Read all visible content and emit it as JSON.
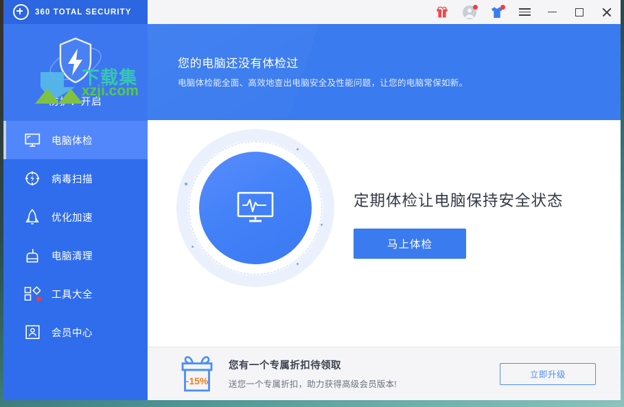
{
  "window": {
    "brand": "360 TOTAL SECURITY",
    "logo_icon": "plus-circle-icon"
  },
  "titlebar": {
    "icons": [
      {
        "name": "gift-icon",
        "badge": false
      },
      {
        "name": "user-avatar-icon",
        "badge": true
      },
      {
        "name": "skin-shirt-icon",
        "badge": true
      },
      {
        "name": "menu-hamburger-icon",
        "badge": false
      }
    ],
    "controls": [
      {
        "name": "minimize-button"
      },
      {
        "name": "maximize-button"
      },
      {
        "name": "close-button"
      }
    ]
  },
  "sidebar": {
    "shield_icon": "shield-bolt-icon",
    "protection_status": "防护：开启",
    "watermark": {
      "cn": "下载集",
      "en": "xzji.com"
    },
    "items": [
      {
        "label": "电脑体检",
        "icon": "monitor-icon",
        "active": true,
        "badge": false
      },
      {
        "label": "病毒扫描",
        "icon": "scan-target-icon",
        "active": false,
        "badge": false
      },
      {
        "label": "优化加速",
        "icon": "rocket-icon",
        "active": false,
        "badge": false
      },
      {
        "label": "电脑清理",
        "icon": "broom-icon",
        "active": false,
        "badge": false
      },
      {
        "label": "工具大全",
        "icon": "toolbox-grid-icon",
        "active": false,
        "badge": true
      },
      {
        "label": "会员中心",
        "icon": "member-card-icon",
        "active": false,
        "badge": false
      }
    ]
  },
  "hero": {
    "title": "您的电脑还没有体检过",
    "subtitle": "电脑体检能全面、高效地查出电脑安全及性能问题，让您的电脑常保如新。"
  },
  "main": {
    "gauge_icon": "monitor-pulse-icon",
    "pitch_title": "定期体检让电脑保持安全状态",
    "scan_button": "马上体检"
  },
  "promo": {
    "gift_icon": "gift-box-icon",
    "discount": "-15%",
    "title": "您有一个专属折扣待领取",
    "subtitle": "送您一个专属折扣，助力获得高级会员版本!",
    "button": "立即升级"
  },
  "colors": {
    "brand_blue": "#2c66e0",
    "sidebar_blue": "#2f6ded",
    "sidebar_active": "#5286fb",
    "hero_blue": "#3a7bef",
    "accent_button": "#3a7bf0",
    "badge_red": "#f23c3c",
    "discount_orange": "#f47b20",
    "promo_bg": "#f5f5f7"
  }
}
